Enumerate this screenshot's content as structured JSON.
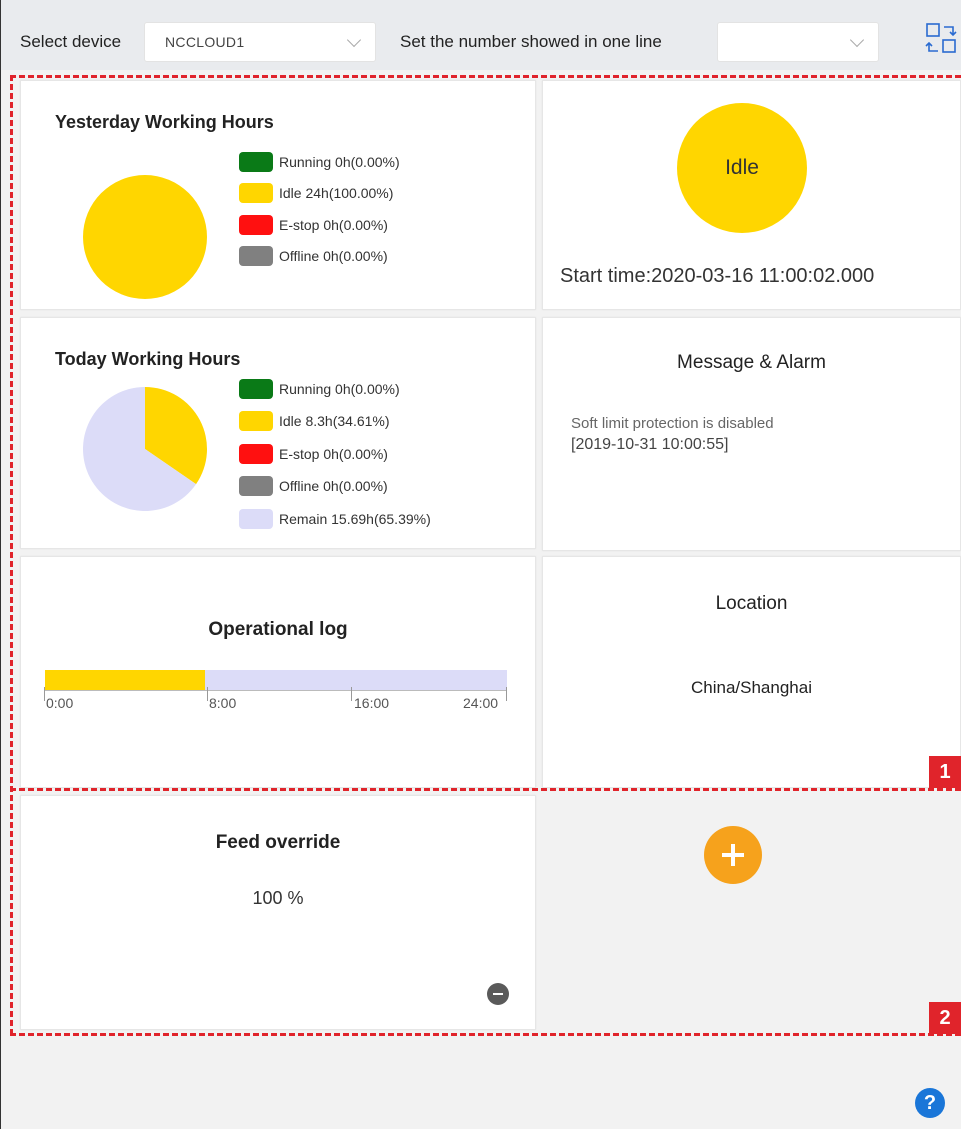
{
  "toolbar": {
    "select_device_label": "Select device",
    "device_value": "NCCLOUD1",
    "per_line_label": "Set the number showed in one line",
    "per_line_value": ""
  },
  "yesterday": {
    "title": "Yesterday Working Hours",
    "legend": [
      {
        "label": "Running 0h(0.00%)",
        "color": "#0a7a17"
      },
      {
        "label": "Idle 24h(100.00%)",
        "color": "#ffd600"
      },
      {
        "label": "E-stop 0h(0.00%)",
        "color": "#ff1010"
      },
      {
        "label": "Offline 0h(0.00%)",
        "color": "#808080"
      }
    ]
  },
  "status": {
    "state": "Idle",
    "start_time": "Start time:2020-03-16 11:00:02.000",
    "color": "#ffd600"
  },
  "today": {
    "title": "Today Working Hours",
    "legend": [
      {
        "label": "Running 0h(0.00%)",
        "color": "#0a7a17"
      },
      {
        "label": "Idle 8.3h(34.61%)",
        "color": "#ffd600"
      },
      {
        "label": "E-stop 0h(0.00%)",
        "color": "#ff1010"
      },
      {
        "label": "Offline 0h(0.00%)",
        "color": "#808080"
      },
      {
        "label": "Remain 15.69h(65.39%)",
        "color": "#dcdcf8"
      }
    ]
  },
  "message": {
    "title": "Message & Alarm",
    "line1": "Soft limit protection is disabled",
    "line2": "[2019-10-31 10:00:55]"
  },
  "oplog": {
    "title": "Operational log",
    "ticks": [
      "0:00",
      "8:00",
      "16:00",
      "24:00"
    ],
    "segments": [
      {
        "state": "Idle",
        "from_h": 0,
        "to_h": 8.3,
        "color": "#ffd600"
      },
      {
        "state": "Remain",
        "from_h": 8.3,
        "to_h": 24,
        "color": "#dcdcf8"
      }
    ]
  },
  "location": {
    "title": "Location",
    "value": "China/Shanghai"
  },
  "feed": {
    "title": "Feed override",
    "value": "100 %"
  },
  "markers": {
    "region1": "1",
    "region2": "2"
  },
  "chart_data": [
    {
      "type": "pie",
      "title": "Yesterday Working Hours",
      "categories": [
        "Running",
        "Idle",
        "E-stop",
        "Offline"
      ],
      "values": [
        0,
        24,
        0,
        0
      ],
      "colors": [
        "#0a7a17",
        "#ffd600",
        "#ff1010",
        "#808080"
      ]
    },
    {
      "type": "pie",
      "title": "Today Working Hours",
      "categories": [
        "Running",
        "Idle",
        "E-stop",
        "Offline",
        "Remain"
      ],
      "values": [
        0,
        8.3,
        0,
        0,
        15.69
      ],
      "colors": [
        "#0a7a17",
        "#ffd600",
        "#ff1010",
        "#808080",
        "#dcdcf8"
      ]
    }
  ]
}
